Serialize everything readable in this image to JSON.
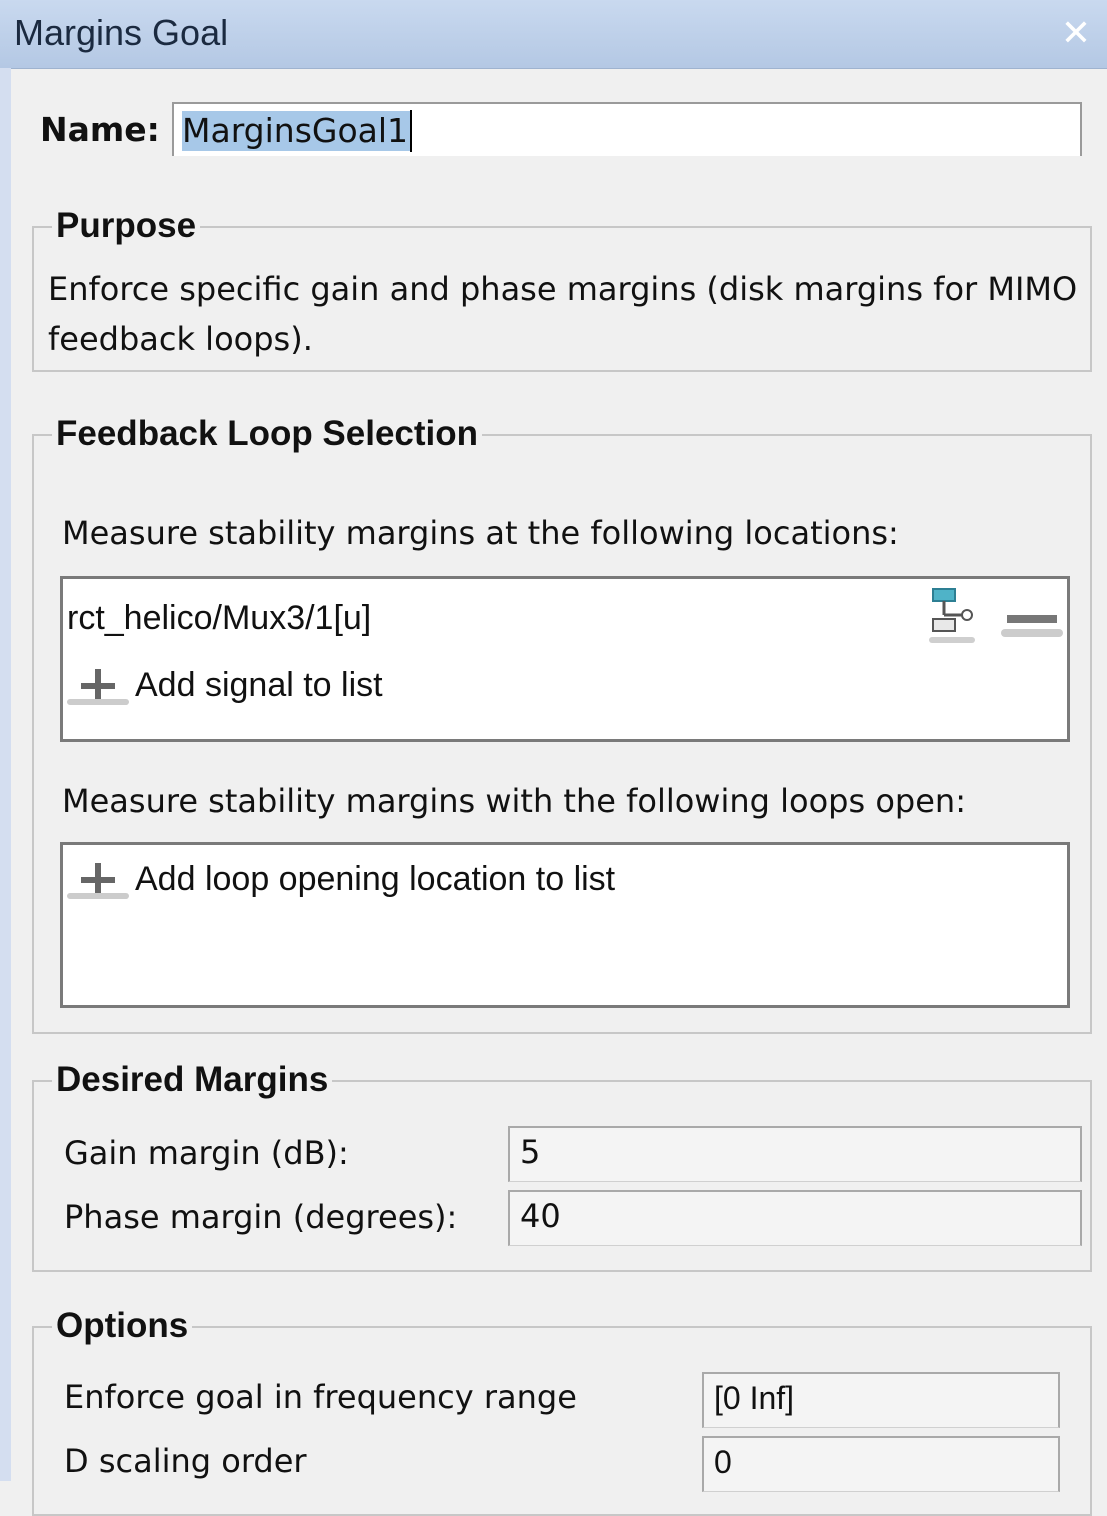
{
  "window": {
    "title": "Margins Goal",
    "close_glyph": "✕"
  },
  "name": {
    "label": "Name:",
    "value": "MarginsGoal1"
  },
  "purpose": {
    "title": "Purpose",
    "text": "Enforce specific gain and phase margins (disk margins for MIMO feedback loops)."
  },
  "feedback": {
    "title": "Feedback Loop Selection",
    "locations_label": "Measure stability margins at the following locations:",
    "locations": [
      {
        "signal": "rct_helico/Mux3/1[u]"
      }
    ],
    "add_signal_label": "Add signal to list",
    "openings_label": "Measure stability margins with the following loops open:",
    "add_opening_label": "Add loop opening location to list"
  },
  "margins": {
    "title": "Desired Margins",
    "gain_label": "Gain margin (dB):",
    "gain_value": "5",
    "phase_label": "Phase margin (degrees):",
    "phase_value": "40"
  },
  "options": {
    "title": "Options",
    "freq_label": "Enforce goal in frequency range",
    "freq_value": "[0 Inf]",
    "dscale_label": "D scaling order",
    "dscale_value": "0"
  },
  "icons": {
    "close": "close-icon",
    "add": "plus-icon",
    "remove": "minus-icon",
    "select_signal": "signal-select-icon"
  },
  "colors": {
    "titlebar": "#b4c8e4",
    "selection": "#a7c8e8",
    "signal_icon": "#4fb3c8"
  }
}
